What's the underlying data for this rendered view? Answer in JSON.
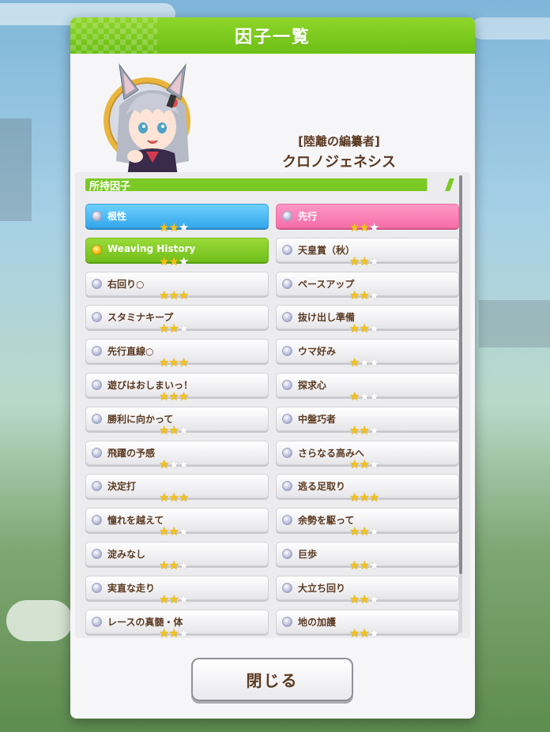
{
  "dialog": {
    "title": "因子一覧",
    "profile": {
      "title": "[陸離の編纂者]",
      "name": "クロノジェネシス"
    },
    "section_label": "所持因子",
    "close_label": "閉じる"
  },
  "factors": [
    {
      "name": "根性",
      "stars": 2,
      "style": "blue"
    },
    {
      "name": "先行",
      "stars": 2,
      "style": "pink"
    },
    {
      "name": "Weaving History",
      "stars": 2,
      "style": "green"
    },
    {
      "name": "天皇賞（秋）",
      "stars": 2,
      "style": "white"
    },
    {
      "name": "右回り○",
      "stars": 3,
      "style": "white"
    },
    {
      "name": "ペースアップ",
      "stars": 2,
      "style": "white"
    },
    {
      "name": "スタミナキープ",
      "stars": 2,
      "style": "white"
    },
    {
      "name": "抜け出し準備",
      "stars": 2,
      "style": "white"
    },
    {
      "name": "先行直線○",
      "stars": 3,
      "style": "white"
    },
    {
      "name": "ウマ好み",
      "stars": 1,
      "style": "white"
    },
    {
      "name": "遊びはおしまいっ！",
      "stars": 3,
      "style": "white"
    },
    {
      "name": "探求心",
      "stars": 1,
      "style": "white"
    },
    {
      "name": "勝利に向かって",
      "stars": 2,
      "style": "white"
    },
    {
      "name": "中盤巧者",
      "stars": 2,
      "style": "white"
    },
    {
      "name": "飛躍の予感",
      "stars": 1,
      "style": "white"
    },
    {
      "name": "さらなる高みへ",
      "stars": 2,
      "style": "white"
    },
    {
      "name": "決定打",
      "stars": 3,
      "style": "white"
    },
    {
      "name": "逃る足取り",
      "stars": 3,
      "style": "white"
    },
    {
      "name": "憧れを越えて",
      "stars": 2,
      "style": "white"
    },
    {
      "name": "余勢を駆って",
      "stars": 2,
      "style": "white"
    },
    {
      "name": "淀みなし",
      "stars": 2,
      "style": "white"
    },
    {
      "name": "巨歩",
      "stars": 2,
      "style": "white"
    },
    {
      "name": "実直な走り",
      "stars": 2,
      "style": "white"
    },
    {
      "name": "大立ち回り",
      "stars": 2,
      "style": "white"
    },
    {
      "name": "レースの真髄・体",
      "stars": 2,
      "style": "white"
    },
    {
      "name": "地の加護",
      "stars": 2,
      "style": "white"
    }
  ],
  "colors": {
    "header_green": "#7bc925",
    "text_brown": "#5b3a22",
    "star_gold": "#f3c21b"
  }
}
